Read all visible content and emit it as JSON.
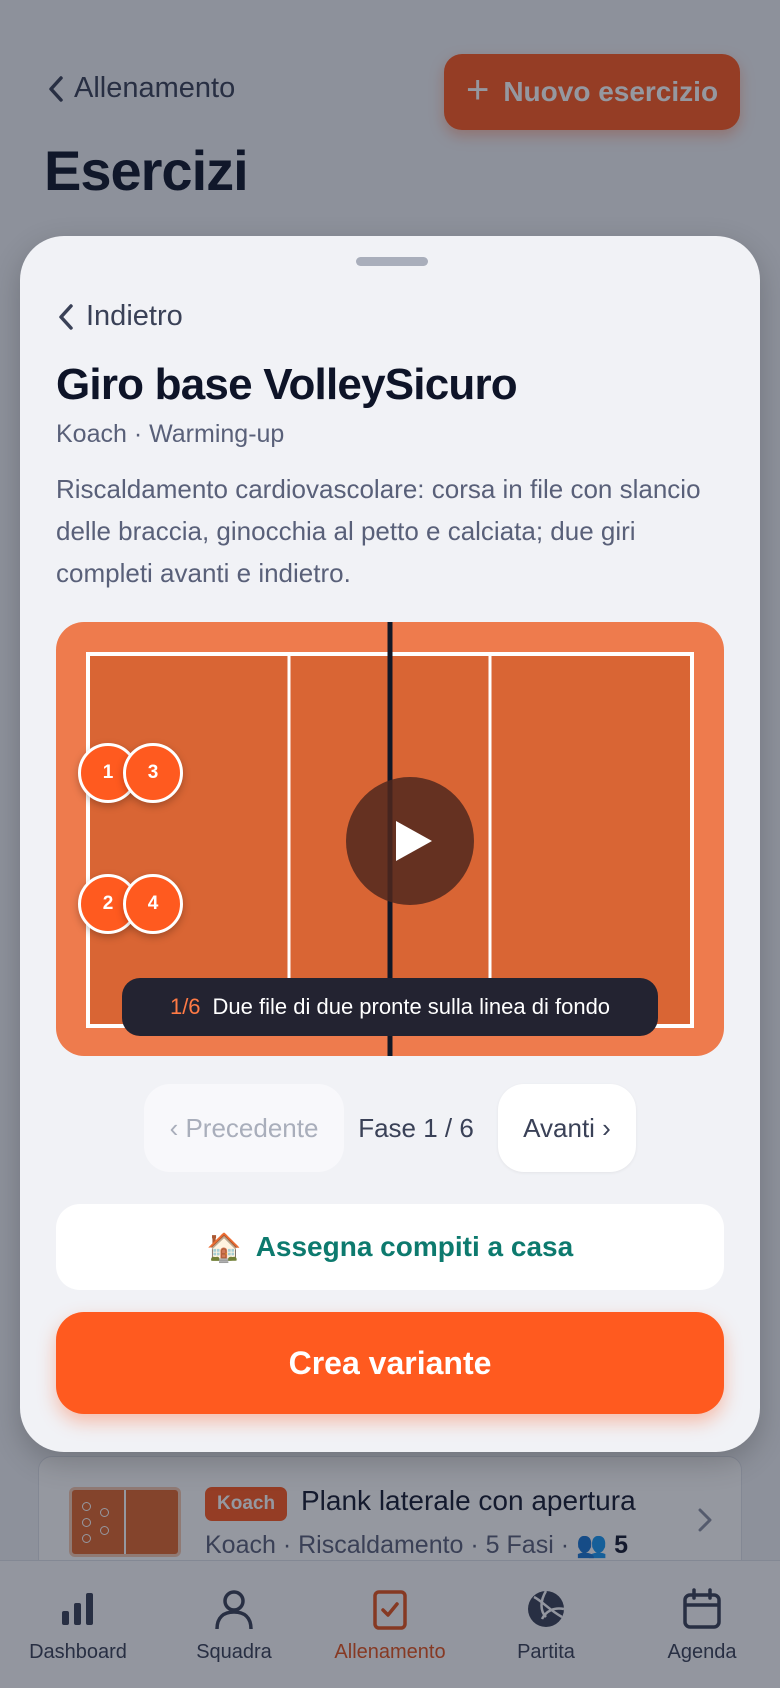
{
  "background": {
    "back_label": "Allenamento",
    "new_button_label": "Nuovo esercizio",
    "page_title": "Esercizi",
    "list_card": {
      "badge": "Koach",
      "title": "Plank laterale con apertura",
      "subtitle": "Koach · Riscaldamento · 5 Fasi · ",
      "count": "5"
    }
  },
  "tabbar": {
    "items": [
      {
        "label": "Dashboard",
        "icon": "bar-chart-icon",
        "active": false
      },
      {
        "label": "Squadra",
        "icon": "person-icon",
        "active": false
      },
      {
        "label": "Allenamento",
        "icon": "clipboard-check-icon",
        "active": true
      },
      {
        "label": "Partita",
        "icon": "volleyball-icon",
        "active": false
      },
      {
        "label": "Agenda",
        "icon": "calendar-icon",
        "active": false
      }
    ]
  },
  "sheet": {
    "back_label": "Indietro",
    "title": "Giro base VolleySicuro",
    "subtitle": "Koach · Warming-up",
    "description": "Riscaldamento cardiovascolare: corsa in file con slancio delle braccia, ginocchia al petto e calciata; due giri completi avanti e indietro.",
    "players": [
      {
        "label": "1"
      },
      {
        "label": "3"
      },
      {
        "label": "2"
      },
      {
        "label": "4"
      }
    ],
    "caption_step": "1/6",
    "caption_text": "Due file di due pronte sulla linea di fondo",
    "prev_label": "‹ Precedente",
    "phase_label": "Fase 1 / 6",
    "next_label": "Avanti ›",
    "homework_emoji": "🏠",
    "homework_label": "Assegna compiti a casa",
    "create_label": "Crea variante"
  },
  "colors": {
    "accent": "#ff5a1f",
    "court": "#e0662d",
    "homework_text": "#0d7a6e"
  }
}
